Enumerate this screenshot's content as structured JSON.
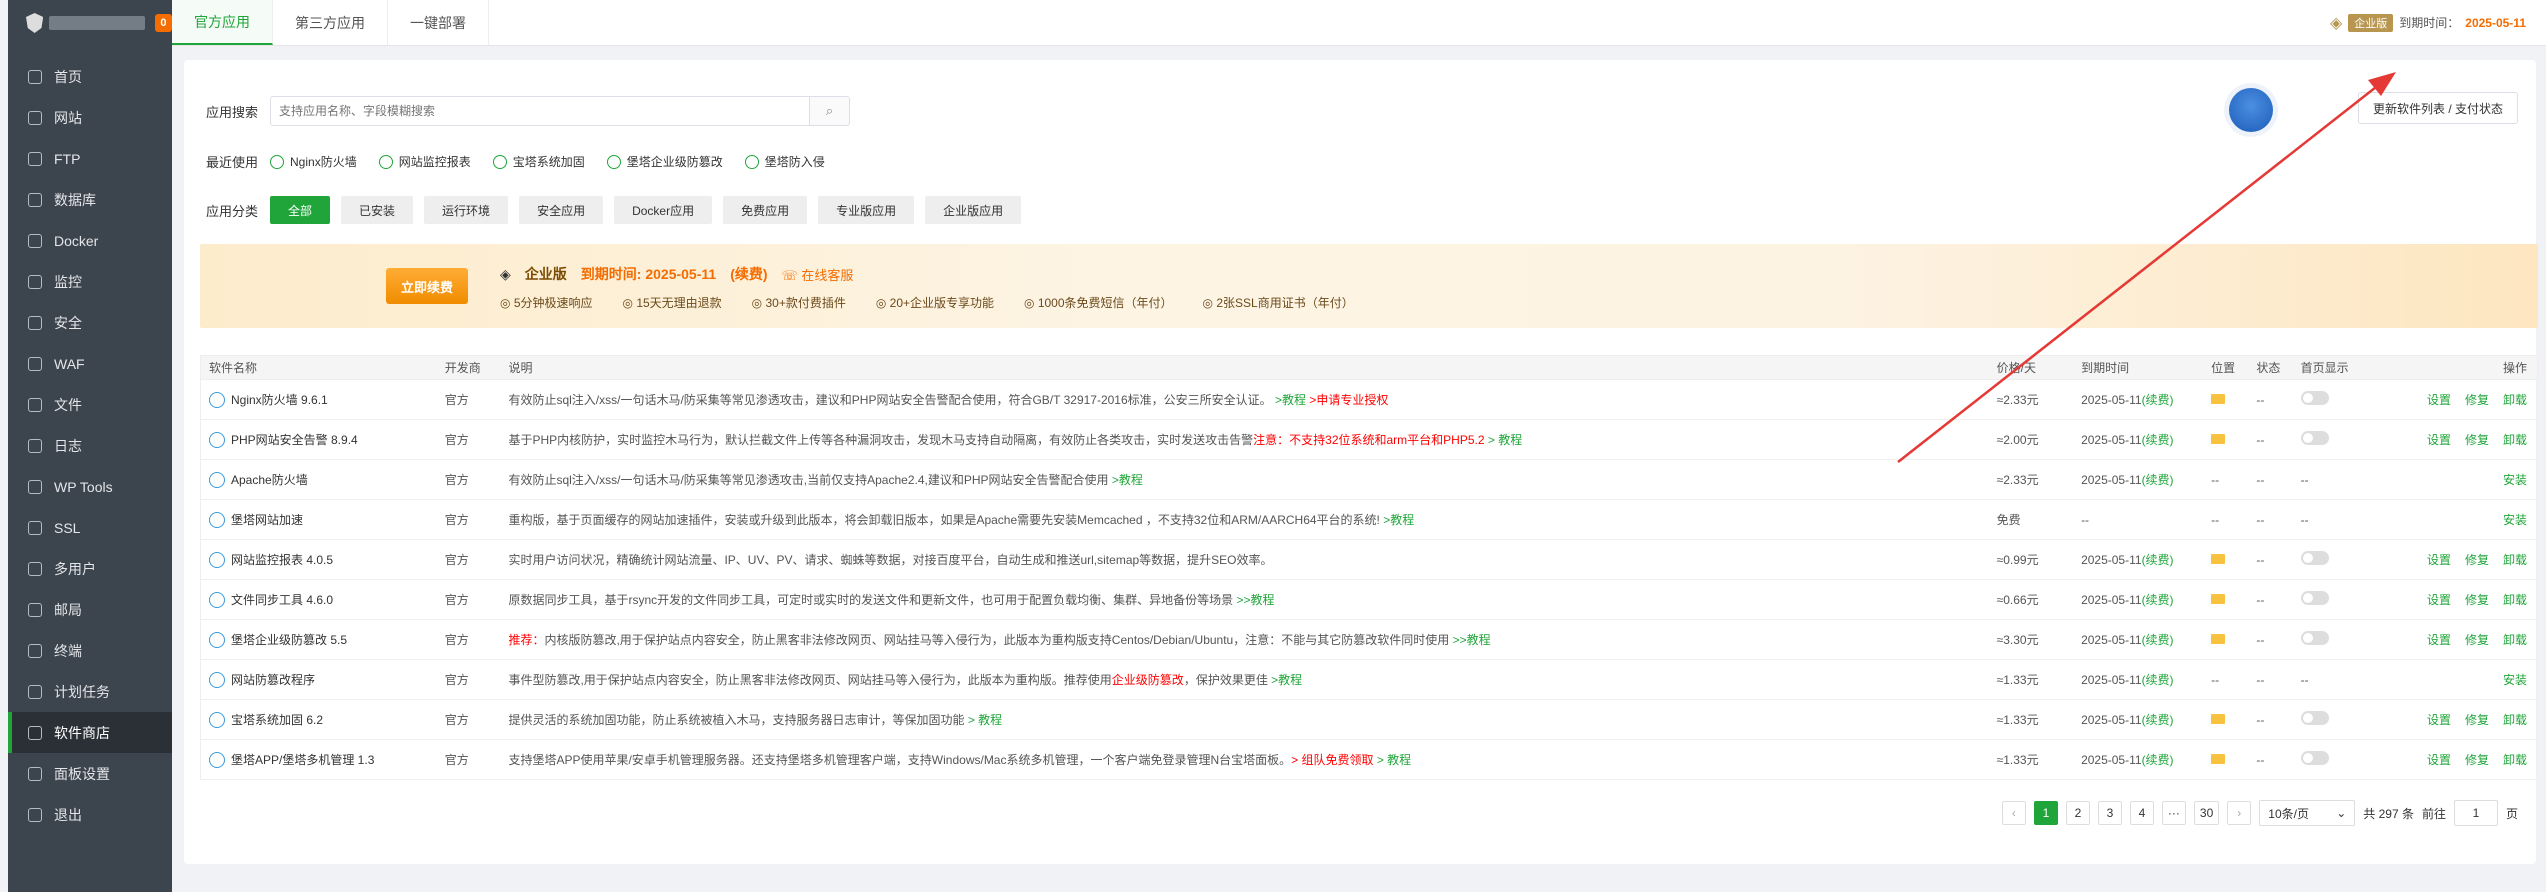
{
  "sidebar": {
    "badge": "0",
    "items": [
      {
        "label": "首页",
        "icon": "home-icon"
      },
      {
        "label": "网站",
        "icon": "globe-icon"
      },
      {
        "label": "FTP",
        "icon": "ftp-icon"
      },
      {
        "label": "数据库",
        "icon": "database-icon"
      },
      {
        "label": "Docker",
        "icon": "docker-icon"
      },
      {
        "label": "监控",
        "icon": "monitor-icon"
      },
      {
        "label": "安全",
        "icon": "shield-icon"
      },
      {
        "label": "WAF",
        "icon": "waf-icon"
      },
      {
        "label": "文件",
        "icon": "folder-icon"
      },
      {
        "label": "日志",
        "icon": "log-icon"
      },
      {
        "label": "WP Tools",
        "icon": "wordpress-icon"
      },
      {
        "label": "SSL",
        "icon": "ssl-icon"
      },
      {
        "label": "多用户",
        "icon": "users-icon"
      },
      {
        "label": "邮局",
        "icon": "mail-icon"
      },
      {
        "label": "终端",
        "icon": "terminal-icon"
      },
      {
        "label": "计划任务",
        "icon": "schedule-icon"
      },
      {
        "label": "软件商店",
        "icon": "store-icon"
      },
      {
        "label": "面板设置",
        "icon": "settings-icon"
      },
      {
        "label": "退出",
        "icon": "logout-icon"
      }
    ]
  },
  "tabs": [
    "官方应用",
    "第三方应用",
    "一键部署"
  ],
  "header": {
    "edition": "企业版",
    "expire_label": "到期时间：",
    "expire_date": "2025-05-11"
  },
  "search": {
    "label": "应用搜索",
    "placeholder": "支持应用名称、字段模糊搜索"
  },
  "update_button": "更新软件列表 / 支付状态",
  "recent": {
    "label": "最近使用",
    "items": [
      "Nginx防火墙",
      "网站监控报表",
      "宝塔系统加固",
      "堡塔企业级防篡改",
      "堡塔防入侵"
    ]
  },
  "categories": {
    "label": "应用分类",
    "items": [
      "全部",
      "已安装",
      "运行环境",
      "安全应用",
      "Docker应用",
      "免费应用",
      "专业版应用",
      "企业版应用"
    ]
  },
  "banner": {
    "renew_button": "立即续费",
    "edition": "企业版",
    "expire": "到期时间: 2025-05-11",
    "renew_link": "(续费)",
    "service": "在线客服",
    "features": [
      "5分钟极速响应",
      "15天无理由退款",
      "30+款付费插件",
      "20+企业版专享功能",
      "1000条免费短信（年付）",
      "2张SSL商用证书（年付）"
    ]
  },
  "table": {
    "headers": [
      "软件名称",
      "开发商",
      "说明",
      "价格/天",
      "到期时间",
      "位置",
      "状态",
      "首页显示",
      "操作"
    ],
    "rows": [
      {
        "name": "Nginx防火墙 9.6.1",
        "dev": "官方",
        "desc": "有效防止sql注入/xss/一句话木马/防采集等常见渗透攻击，建议和PHP网站安全告警配合使用，符合GB/T 32917-2016标准，公安三所安全认证。",
        "tail": ">教程",
        "extra": ">申请专业授权",
        "price": "≈2.33元",
        "expire": "2025-05-11",
        "renew": "(续费)",
        "folder": true,
        "status": "--",
        "toggle": true,
        "ops": [
          "设置",
          "修复",
          "卸载"
        ]
      },
      {
        "name": "PHP网站安全告警 8.9.4",
        "dev": "官方",
        "desc": "基于PHP内核防护，实时监控木马行为，默认拦截文件上传等各种漏洞攻击，发现木马支持自动隔离，有效防止各类攻击，实时发送攻击告警",
        "red": "注意：不支持32位系统和arm平台和PHP5.2",
        "tail": "> 教程",
        "price": "≈2.00元",
        "expire": "2025-05-11",
        "renew": "(续费)",
        "folder": true,
        "status": "--",
        "toggle": true,
        "ops": [
          "设置",
          "修复",
          "卸载"
        ]
      },
      {
        "name": "Apache防火墙",
        "dev": "官方",
        "desc": "有效防止sql注入/xss/一句话木马/防采集等常见渗透攻击,当前仅支持Apache2.4,建议和PHP网站安全告警配合使用",
        "tail": ">教程",
        "price": "≈2.33元",
        "expire": "2025-05-11",
        "renew": "(续费)",
        "folder": false,
        "status": "--",
        "toggle": false,
        "ops": [
          "安装"
        ]
      },
      {
        "name": "堡塔网站加速",
        "dev": "官方",
        "desc": "重构版，基于页面缓存的网站加速插件，安装或升级到此版本，将会卸载旧版本，如果是Apache需要先安装Memcached ，不支持32位和ARM/AARCH64平台的系统!",
        "tail": ">教程",
        "price": "免费",
        "expire": "--",
        "renew": "",
        "folder": false,
        "status": "--",
        "toggle": false,
        "ops": [
          "安装"
        ]
      },
      {
        "name": "网站监控报表 4.0.5",
        "dev": "官方",
        "desc": "实时用户访问状况，精确统计网站流量、IP、UV、PV、请求、蜘蛛等数据，对接百度平台，自动生成和推送url,sitemap等数据，提升SEO效率。",
        "tail": "",
        "price": "≈0.99元",
        "expire": "2025-05-11",
        "renew": "(续费)",
        "folder": true,
        "status": "--",
        "toggle": true,
        "ops": [
          "设置",
          "修复",
          "卸载"
        ]
      },
      {
        "name": "文件同步工具 4.6.0",
        "dev": "官方",
        "desc": "原数据同步工具，基于rsync开发的文件同步工具，可定时或实时的发送文件和更新文件，也可用于配置负载均衡、集群、异地备份等场景",
        "tail": ">>教程",
        "price": "≈0.66元",
        "expire": "2025-05-11",
        "renew": "(续费)",
        "folder": true,
        "status": "--",
        "toggle": true,
        "ops": [
          "设置",
          "修复",
          "卸载"
        ]
      },
      {
        "name": "堡塔企业级防篡改 5.5",
        "dev": "官方",
        "red_pre": "推荐：",
        "desc": "内核版防篡改,用于保护站点内容安全，防止黑客非法修改网页、网站挂马等入侵行为，此版本为重构版支持Centos/Debian/Ubuntu，注意：不能与其它防篡改软件同时使用",
        "tail": ">>教程",
        "price": "≈3.30元",
        "expire": "2025-05-11",
        "renew": "(续费)",
        "folder": true,
        "status": "--",
        "toggle": true,
        "ops": [
          "设置",
          "修复",
          "卸载"
        ]
      },
      {
        "name": "网站防篡改程序",
        "dev": "官方",
        "desc": "事件型防篡改,用于保护站点内容安全，防止黑客非法修改网页、网站挂马等入侵行为，此版本为重构版。推荐使用",
        "red": "企业级防篡改",
        "desc2": "，保护效果更佳",
        "tail": ">教程",
        "price": "≈1.33元",
        "expire": "2025-05-11",
        "renew": "(续费)",
        "folder": false,
        "status": "--",
        "toggle": false,
        "ops": [
          "安装"
        ]
      },
      {
        "name": "宝塔系统加固 6.2",
        "dev": "官方",
        "desc": "提供灵活的系统加固功能，防止系统被植入木马，支持服务器日志审计，等保加固功能",
        "tail": "> 教程",
        "price": "≈1.33元",
        "expire": "2025-05-11",
        "renew": "(续费)",
        "folder": true,
        "status": "--",
        "toggle": true,
        "ops": [
          "设置",
          "修复",
          "卸载"
        ]
      },
      {
        "name": "堡塔APP/堡塔多机管理 1.3",
        "dev": "官方",
        "desc": "支持堡塔APP使用苹果/安卓手机管理服务器。还支持堡塔多机管理客户端，支持Windows/Mac系统多机管理，一个客户端免登录管理N台宝塔面板。",
        "red": "> 组队免费领取",
        "tail": "> 教程",
        "price": "≈1.33元",
        "expire": "2025-05-11",
        "renew": "(续费)",
        "folder": true,
        "status": "--",
        "toggle": true,
        "ops": [
          "设置",
          "修复",
          "卸载"
        ]
      }
    ]
  },
  "pager": {
    "pages": [
      "1",
      "2",
      "3",
      "4",
      "···",
      "30"
    ],
    "per_page": "10条/页",
    "total": "共 297 条",
    "goto_label": "前往",
    "goto_value": "1",
    "page_suffix": "页"
  },
  "colors": {
    "accent": "#20a53a",
    "warn": "#f56c00",
    "sidebar": "#3c444d",
    "annotation": "#e53935"
  }
}
